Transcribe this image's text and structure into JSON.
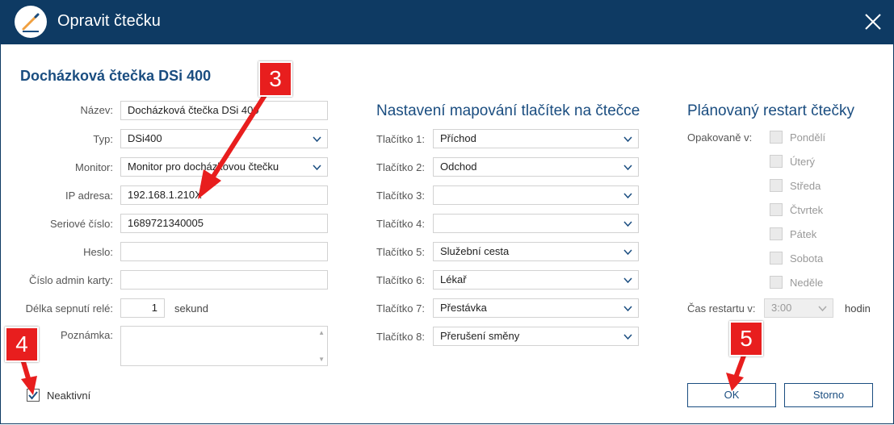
{
  "window": {
    "title": "Opravit čtečku"
  },
  "form": {
    "heading": "Docházková čtečka DSi 400",
    "fields": {
      "name": {
        "label": "Název:",
        "value": "Docházková čtečka DSi 400"
      },
      "type": {
        "label": "Typ:",
        "value": "DSi400"
      },
      "monitor": {
        "label": "Monitor:",
        "value": "Monitor pro docházkovou čtečku"
      },
      "ip": {
        "label": "IP adresa:",
        "value": "192.168.1.210X"
      },
      "serial": {
        "label": "Seriové číslo:",
        "value": "1689721340005"
      },
      "password": {
        "label": "Heslo:",
        "value": ""
      },
      "admin_card": {
        "label": "Číslo admin karty:",
        "value": ""
      },
      "relay": {
        "label": "Délka sepnutí relé:",
        "value": "1",
        "unit": "sekund"
      },
      "note": {
        "label": "Poznámka:",
        "value": ""
      }
    },
    "inactive": {
      "label": "Neaktivní",
      "checked": true
    }
  },
  "buttons_section": {
    "title": "Nastavení mapování tlačítek na čtečce",
    "items": [
      {
        "label": "Tlačítko 1:",
        "value": "Příchod"
      },
      {
        "label": "Tlačítko 2:",
        "value": "Odchod"
      },
      {
        "label": "Tlačítko 3:",
        "value": ""
      },
      {
        "label": "Tlačítko 4:",
        "value": ""
      },
      {
        "label": "Tlačítko 5:",
        "value": "Služební cesta"
      },
      {
        "label": "Tlačítko 6:",
        "value": "Lékař"
      },
      {
        "label": "Tlačítko 7:",
        "value": "Přestávka"
      },
      {
        "label": "Tlačítko 8:",
        "value": "Přerušení směny"
      }
    ]
  },
  "restart": {
    "title": "Plánovaný restart čtečky",
    "repeat_label": "Opakovaně v:",
    "days": [
      "Pondělí",
      "Úterý",
      "Středa",
      "Čtvrtek",
      "Pátek",
      "Sobota",
      "Neděle"
    ],
    "time_label": "Čas restartu v:",
    "time_value": "3:00",
    "time_unit": "hodin"
  },
  "actions": {
    "ok": "OK",
    "cancel": "Storno"
  },
  "annotations": {
    "badge3": "3",
    "badge4": "4",
    "badge5": "5"
  },
  "colors": {
    "titlebar": "#0e3a63",
    "accent": "#1a4d80",
    "annotation": "#e81e1e"
  }
}
